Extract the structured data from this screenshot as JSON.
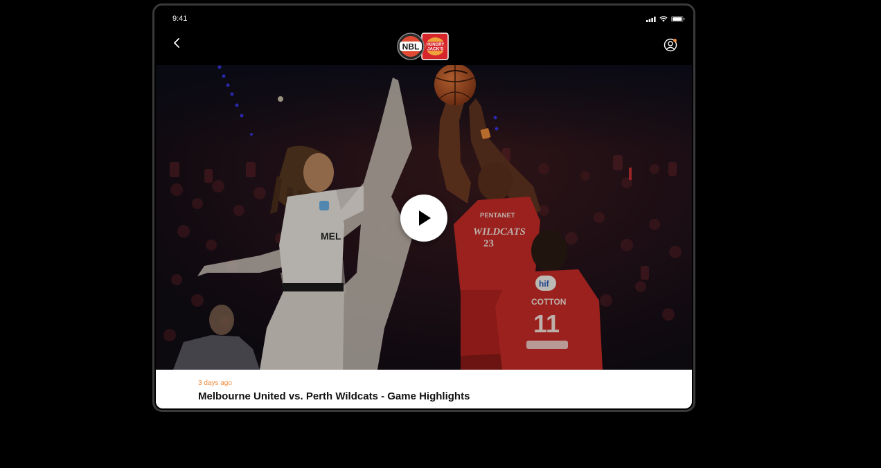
{
  "status_bar": {
    "time": "9:41"
  },
  "nav": {
    "logo_left": "NBL",
    "logo_right_line1": "HUNGRY",
    "logo_right_line2": "JACK'S"
  },
  "video": {
    "posted": "3 days ago",
    "title": "Melbourne United vs. Perth Wildcats - Game Highlights"
  },
  "jerseys": {
    "white_partial": "MEL",
    "red_sponsor": "PENTANET",
    "red_team": "WILDCATS",
    "red_number": "23",
    "second_sponsor": "hif",
    "second_name": "COTTON",
    "second_number": "11"
  },
  "colors": {
    "accent": "#f28b3a",
    "wildcats_red": "#c62b26"
  },
  "icons": {
    "back": "chevron-left-icon",
    "profile": "user-icon",
    "play": "play-icon"
  }
}
